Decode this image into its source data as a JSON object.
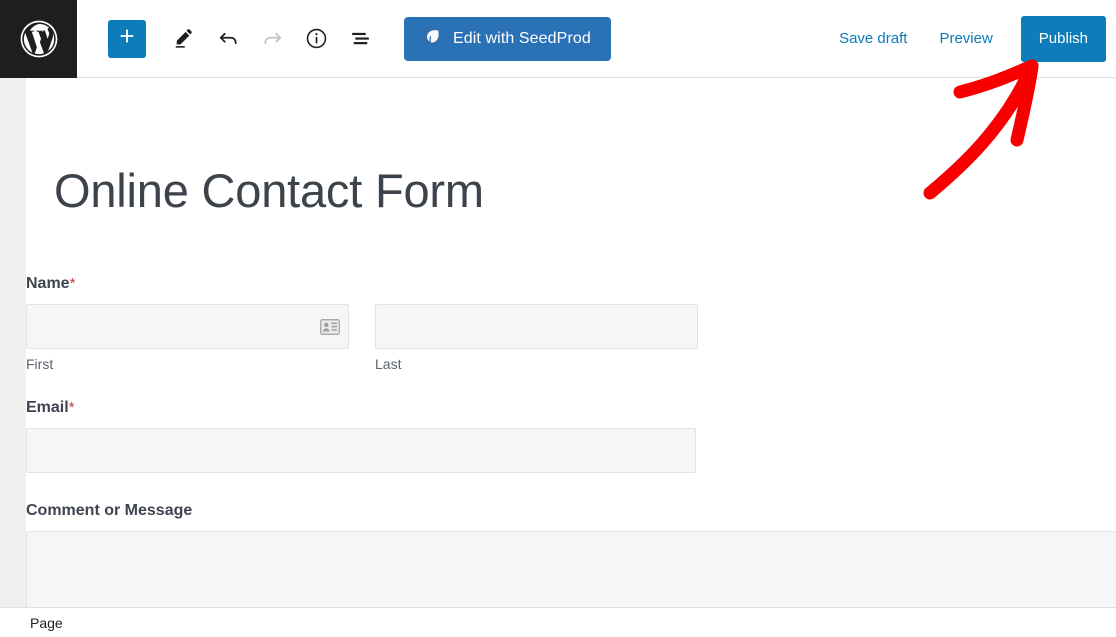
{
  "header": {
    "wp_logo_icon": "wordpress-logo-icon",
    "add_block_label": "+",
    "add_block_icon": "plus-icon",
    "tools_icon": "pencil-icon",
    "undo_icon": "undo-arrow-icon",
    "redo_icon": "redo-arrow-icon",
    "details_icon": "info-circle-icon",
    "list_view_icon": "list-view-icon",
    "seedprod": {
      "label": "Edit with SeedProd",
      "icon": "seedprod-leaf-icon",
      "bg_color": "#2a72b5"
    },
    "save_draft_label": "Save draft",
    "preview_label": "Preview",
    "publish_label": "Publish",
    "accent_color": "#0d7cba",
    "logo_bg_color": "#1e1e1e"
  },
  "canvas": {
    "post_title": "Online Contact Form"
  },
  "form": {
    "fields": [
      {
        "label": "Name",
        "required": true,
        "required_marker": "*",
        "type": "name-split",
        "columns": [
          {
            "value": "",
            "sub_label": "First",
            "has_autofill_icon": true,
            "autofill_icon": "contact-card-icon"
          },
          {
            "value": "",
            "sub_label": "Last",
            "has_autofill_icon": false
          }
        ]
      },
      {
        "label": "Email",
        "required": true,
        "required_marker": "*",
        "type": "text",
        "value": ""
      },
      {
        "label": "Comment or Message",
        "required": false,
        "required_marker": "",
        "type": "textarea",
        "value": ""
      }
    ],
    "required_color": "#d63638",
    "input_bg_color": "#f6f6f6",
    "input_border_color": "#e3e3e3"
  },
  "breadcrumb": {
    "items": [
      "Page"
    ]
  },
  "annotation": {
    "type": "arrow",
    "color": "#f80000",
    "points_to": "publish-button",
    "direction": "up-right"
  }
}
